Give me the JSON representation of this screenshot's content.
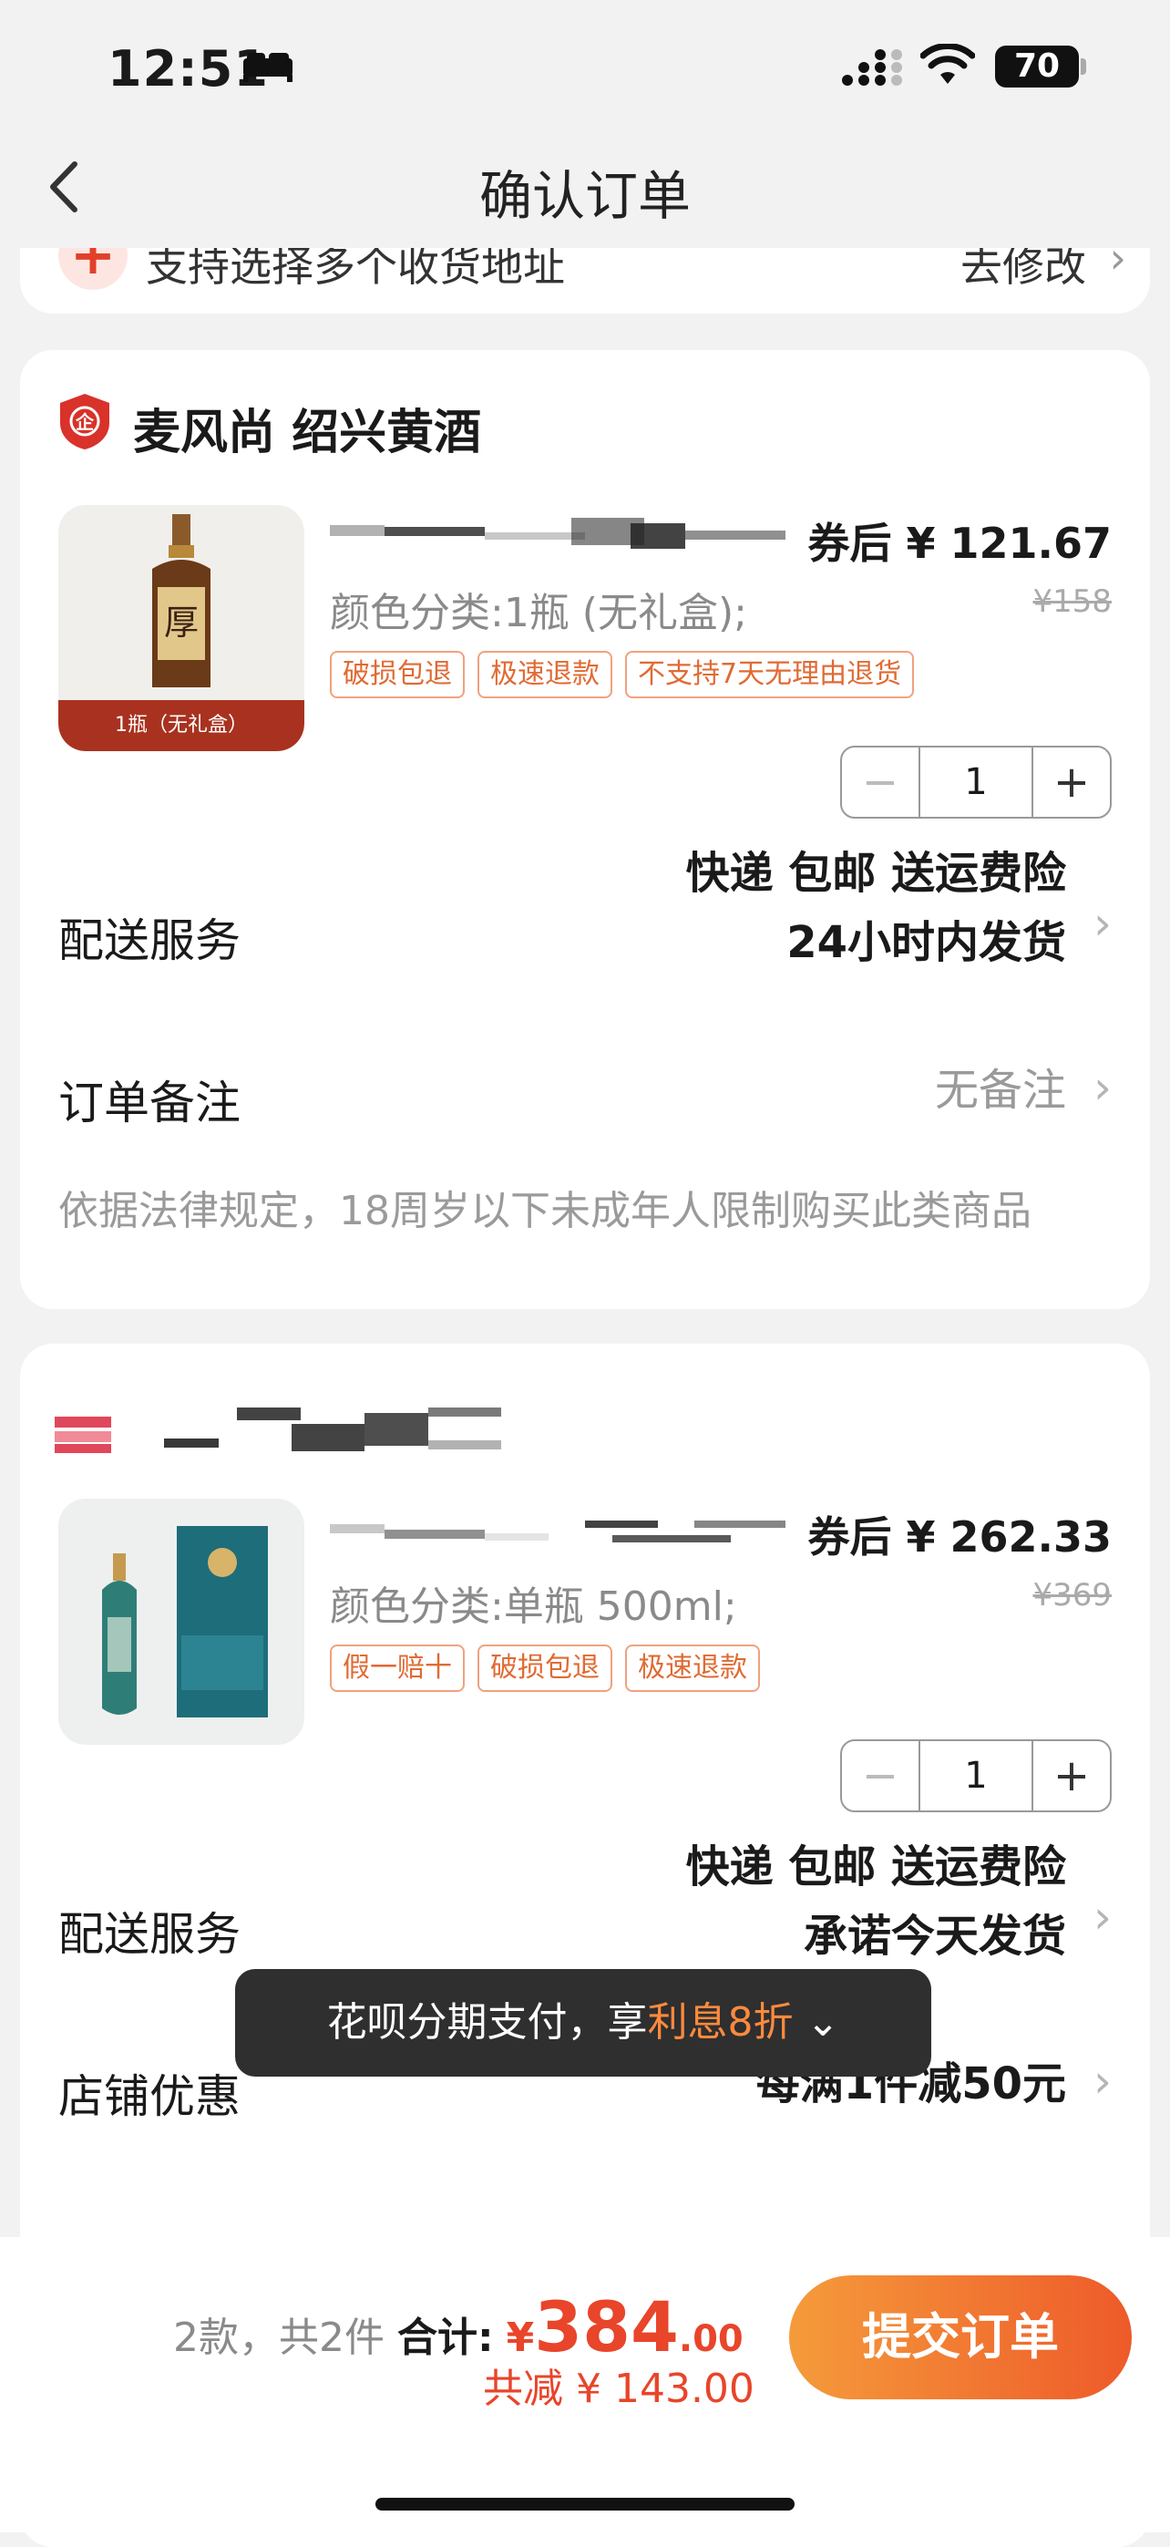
{
  "status_bar": {
    "time": "12:51",
    "battery": "70"
  },
  "nav": {
    "title": "确认订单"
  },
  "address": {
    "text": "支持选择多个收货地址",
    "edit": "去修改"
  },
  "orders": [
    {
      "shop_name": "麦风尚 绍兴黄酒",
      "image_label": "1瓶（无礼盒）",
      "price": "券后 ¥ 121.67",
      "original_price": "¥158",
      "variant": "颜色分类:1瓶 (无礼盒);",
      "tags": [
        "破损包退",
        "极速退款",
        "不支持7天无理由退货"
      ],
      "quantity": "1",
      "delivery_label": "配送服务",
      "delivery_line1": "快递 包邮 送运费险",
      "delivery_line2": "24小时内发货",
      "remark_label": "订单备注",
      "remark_value": "无备注",
      "legal": "依据法律规定，18周岁以下未成年人限制购买此类商品"
    },
    {
      "price": "券后 ¥ 262.33",
      "original_price": "¥369",
      "variant": "颜色分类:单瓶 500ml;",
      "tags": [
        "假一赔十",
        "破损包退",
        "极速退款"
      ],
      "quantity": "1",
      "delivery_label": "配送服务",
      "delivery_line1": "快递 包邮 送运费险",
      "delivery_line2": "承诺今天发货",
      "discount_label": "店铺优惠",
      "discount_value": "每满1件减50元"
    }
  ],
  "toast": {
    "prefix": "花呗分期支付，享",
    "highlight": "利息8折",
    "suffix": "⌄"
  },
  "summary": {
    "count": "2款，共2件",
    "total_label": "合计:",
    "yen": "¥",
    "total_int": "384",
    "total_dec": ".00",
    "saved": "共减 ¥ 143.00",
    "submit": "提交订单"
  },
  "colors": {
    "accent": "#e8452a",
    "submit_start": "#f59b3b",
    "submit_end": "#ee5a2a"
  }
}
